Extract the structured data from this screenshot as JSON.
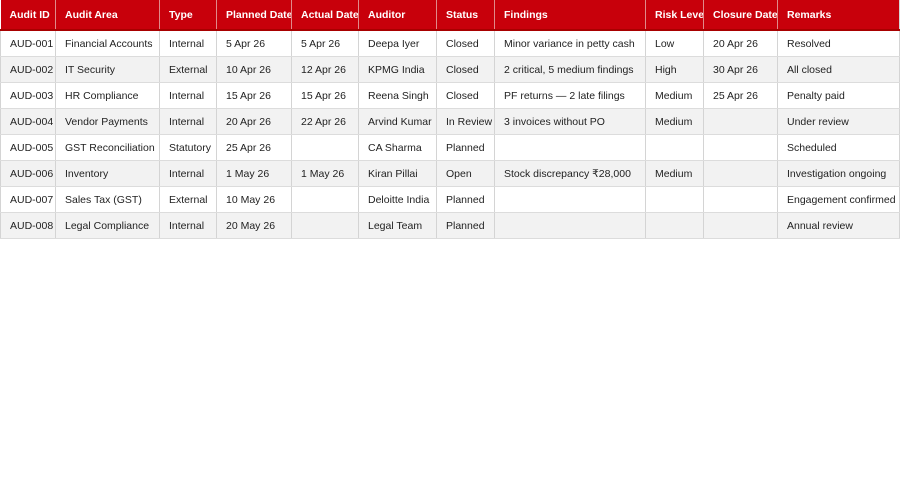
{
  "colors": {
    "header_bg": "#c8000b",
    "header_text": "#ffffff",
    "row_alt_bg": "#f2f2f2",
    "grid_line": "#d4d4d4"
  },
  "table": {
    "columns": [
      "Audit ID",
      "Audit Area",
      "Type",
      "Planned Date",
      "Actual Date",
      "Auditor",
      "Status",
      "Findings",
      "Risk Level",
      "Closure Date",
      "Remarks"
    ],
    "rows": [
      [
        "AUD-001",
        "Financial Accounts",
        "Internal",
        "5 Apr 26",
        "5 Apr 26",
        "Deepa Iyer",
        "Closed",
        "Minor variance in petty cash",
        "Low",
        "20 Apr 26",
        "Resolved"
      ],
      [
        "AUD-002",
        "IT Security",
        "External",
        "10 Apr 26",
        "12 Apr 26",
        "KPMG India",
        "Closed",
        "2 critical, 5 medium findings",
        "High",
        "30 Apr 26",
        "All closed"
      ],
      [
        "AUD-003",
        "HR Compliance",
        "Internal",
        "15 Apr 26",
        "15 Apr 26",
        "Reena Singh",
        "Closed",
        "PF returns — 2 late filings",
        "Medium",
        "25 Apr 26",
        "Penalty paid"
      ],
      [
        "AUD-004",
        "Vendor Payments",
        "Internal",
        "20 Apr 26",
        "22 Apr 26",
        "Arvind Kumar",
        "In Review",
        "3 invoices without PO",
        "Medium",
        "",
        "Under review"
      ],
      [
        "AUD-005",
        "GST Reconciliation",
        "Statutory",
        "25 Apr 26",
        "",
        "CA Sharma",
        "Planned",
        "",
        "",
        "",
        "Scheduled"
      ],
      [
        "AUD-006",
        "Inventory",
        "Internal",
        "1 May 26",
        "1 May 26",
        "Kiran Pillai",
        "Open",
        "Stock discrepancy ₹28,000",
        "Medium",
        "",
        "Investigation ongoing"
      ],
      [
        "AUD-007",
        "Sales Tax (GST)",
        "External",
        "10 May 26",
        "",
        "Deloitte India",
        "Planned",
        "",
        "",
        "",
        "Engagement confirmed"
      ],
      [
        "AUD-008",
        "Legal Compliance",
        "Internal",
        "20 May 26",
        "",
        "Legal Team",
        "Planned",
        "",
        "",
        "",
        "Annual review"
      ]
    ]
  }
}
